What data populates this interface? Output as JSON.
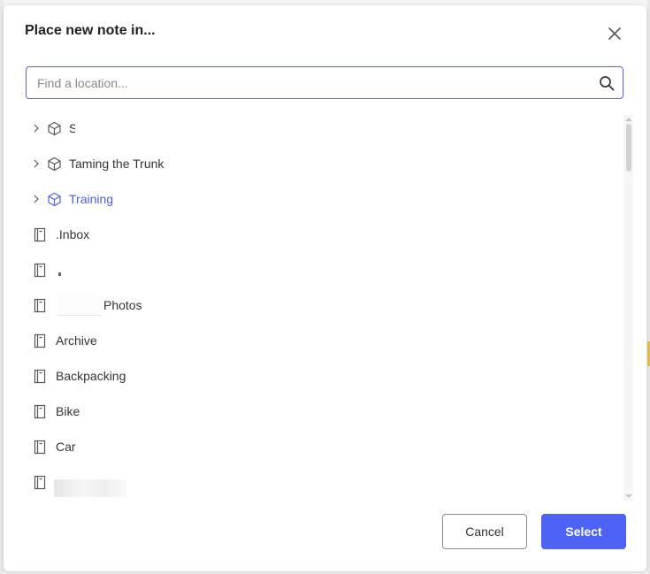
{
  "dialog": {
    "title": "Place new note in...",
    "close_icon": "close-icon"
  },
  "search": {
    "placeholder": "Find a location...",
    "value": "",
    "icon": "search-icon"
  },
  "tree": {
    "spaces": [
      {
        "label": "S",
        "icon": "space-cube-icon",
        "expandable": true,
        "active": false
      },
      {
        "label": "Taming the Trunk",
        "icon": "space-cube-icon",
        "expandable": true,
        "active": false
      },
      {
        "label": "Training",
        "icon": "space-cube-icon",
        "expandable": true,
        "active": true
      }
    ],
    "notebooks": [
      {
        "label": ".Inbox",
        "icon": "notebook-icon"
      },
      {
        "label": "",
        "icon": "notebook-icon"
      },
      {
        "label": "Photos",
        "icon": "notebook-icon"
      },
      {
        "label": "Archive",
        "icon": "notebook-icon"
      },
      {
        "label": "Backpacking",
        "icon": "notebook-icon"
      },
      {
        "label": "Bike",
        "icon": "notebook-icon"
      },
      {
        "label": "Car",
        "icon": "notebook-icon"
      },
      {
        "label": "",
        "icon": "notebook-icon"
      }
    ]
  },
  "footer": {
    "cancel_label": "Cancel",
    "select_label": "Select"
  },
  "colors": {
    "accent": "#4e62f5",
    "active_text": "#4a5de8",
    "search_border": "#5063f0"
  }
}
